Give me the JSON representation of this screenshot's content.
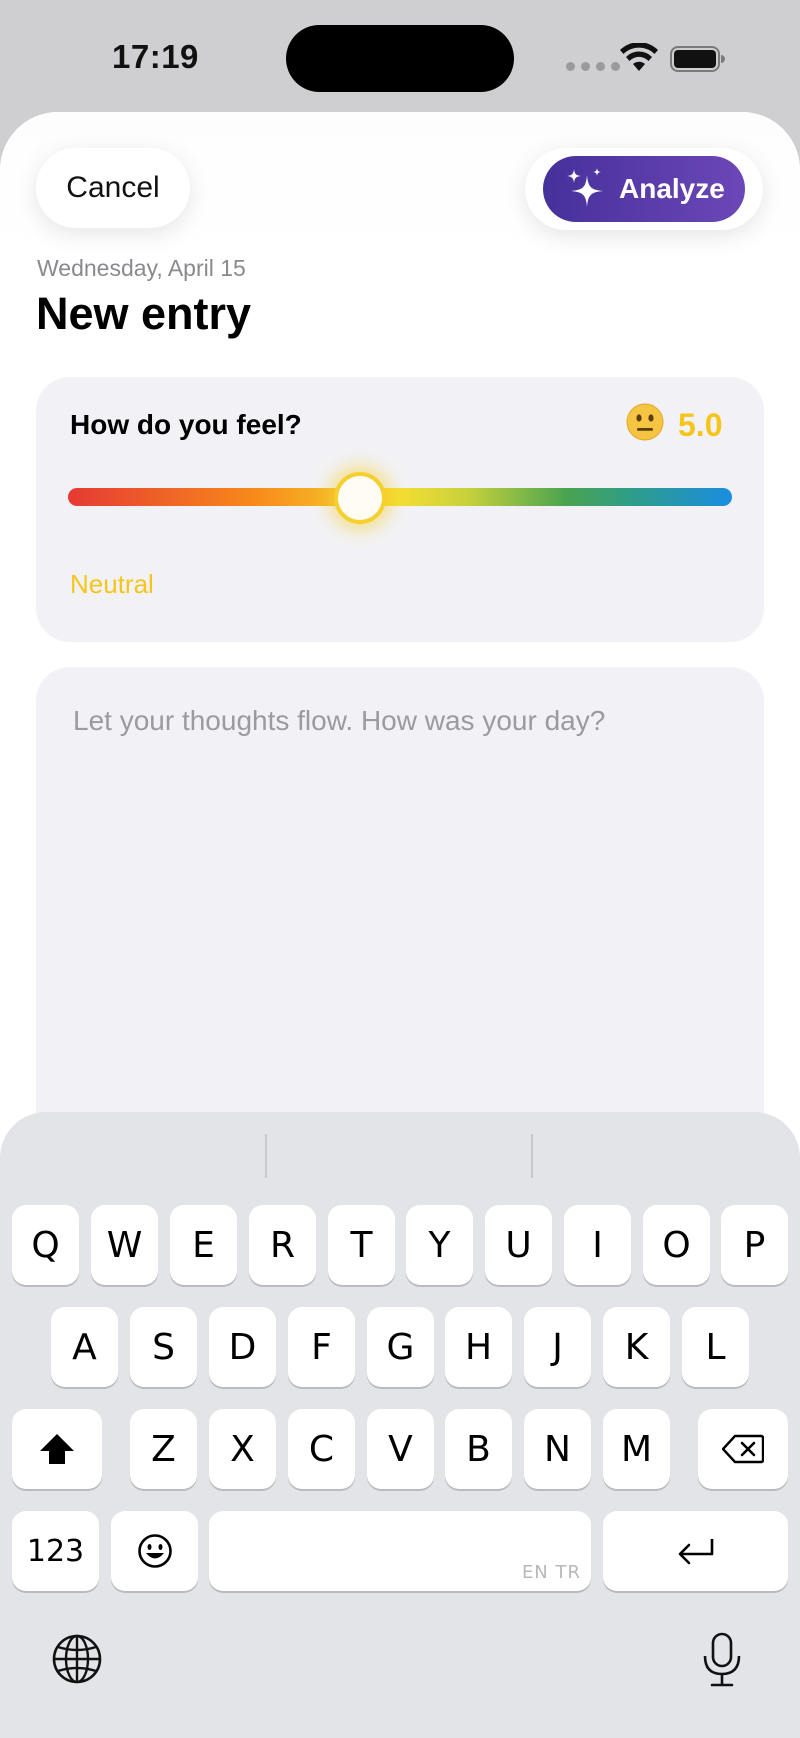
{
  "status_bar": {
    "time": "17:19"
  },
  "header": {
    "cancel_label": "Cancel",
    "analyze_label": "Analyze",
    "date": "Wednesday, April 15",
    "title": "New entry"
  },
  "mood": {
    "question": "How do you feel?",
    "score": "5.0",
    "label": "Neutral",
    "emoji": "neutral-face-icon",
    "slider_fraction": 0.44,
    "accent_color": "#F5C51C"
  },
  "journal": {
    "placeholder": "Let your thoughts flow. How was your day?",
    "value": ""
  },
  "keyboard": {
    "row1": [
      "Q",
      "W",
      "E",
      "R",
      "T",
      "Y",
      "U",
      "I",
      "O",
      "P"
    ],
    "row2": [
      "A",
      "S",
      "D",
      "F",
      "G",
      "H",
      "J",
      "K",
      "L"
    ],
    "row3": [
      "Z",
      "X",
      "C",
      "V",
      "B",
      "N",
      "M"
    ],
    "numbers_label": "123",
    "space_languages": "EN TR",
    "icons": [
      "shift-icon",
      "backspace-icon",
      "emoji-icon",
      "return-icon",
      "globe-icon",
      "microphone-icon"
    ]
  },
  "colors": {
    "analyze_start": "#46309A",
    "analyze_end": "#6C47B8"
  }
}
